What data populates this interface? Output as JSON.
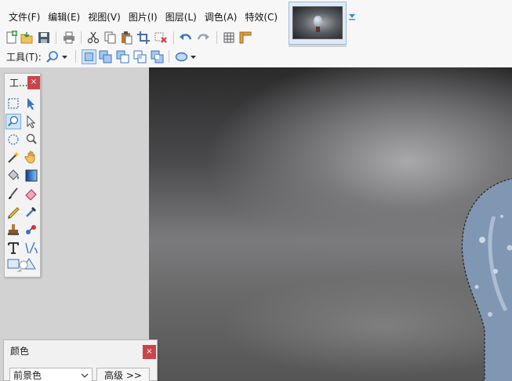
{
  "menu": {
    "items": [
      "文件(F)",
      "编辑(E)",
      "视图(V)",
      "图片(I)",
      "图层(L)",
      "调色(A)",
      "特效(C)"
    ]
  },
  "toolbar_secondary": {
    "tools_label": "工具(T):"
  },
  "toolbox": {
    "title": "工...",
    "close": "×"
  },
  "color_panel": {
    "title": "颜色",
    "close": "×",
    "select_value": "前景色",
    "advanced_label": "高级 >>"
  },
  "colors": {
    "accent": "#4a7fb8",
    "close_red": "#c9454a",
    "active_bg": "#cfe3f7"
  },
  "icons": [
    "new-image-icon",
    "open-icon",
    "save-icon",
    "print-icon",
    "cut-icon",
    "copy-icon",
    "paste-icon",
    "crop-icon",
    "deselect-icon",
    "undo-icon",
    "redo-icon",
    "grid-icon",
    "ruler-icon",
    "zoom-icon",
    "rectangle-select-icon",
    "move-selection-icon",
    "lasso-icon",
    "ellipse-select-icon",
    "magic-wand-icon",
    "pan-icon",
    "paint-bucket-icon",
    "gradient-icon",
    "paintbrush-icon",
    "eraser-icon",
    "pencil-icon",
    "color-picker-icon",
    "clone-stamp-icon",
    "recolor-icon",
    "text-icon",
    "line-curve-icon",
    "shapes-icon"
  ]
}
